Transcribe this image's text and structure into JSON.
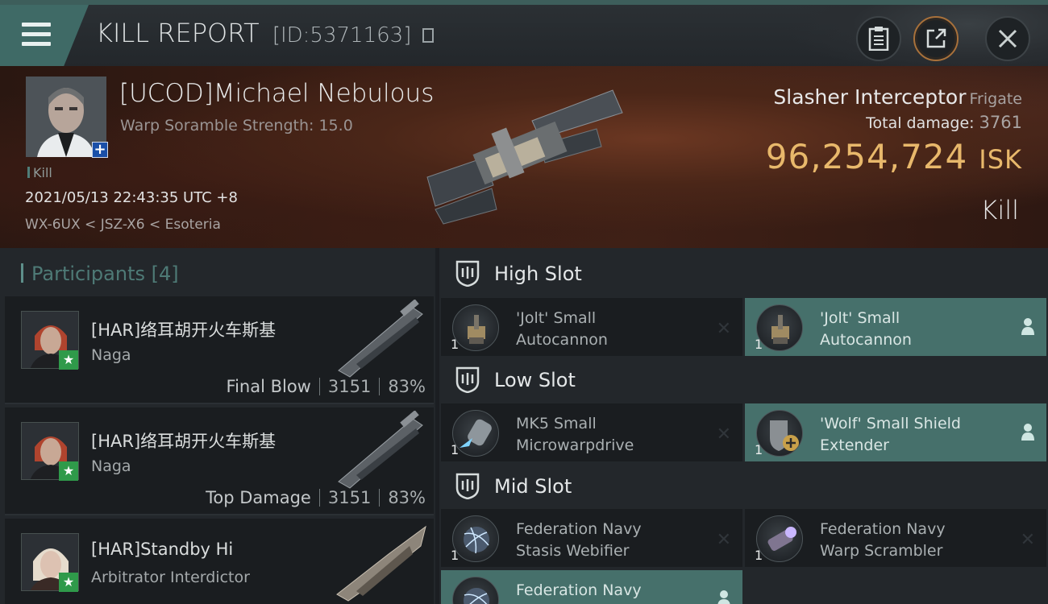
{
  "header": {
    "title": "KILL REPORT",
    "report_id": "[ID:5371163]",
    "buttons": [
      "clipboard",
      "share",
      "close"
    ]
  },
  "victim": {
    "name": "[UCOD]Michael Nebulous",
    "scramble": "Warp Soramble Strength: 15.0",
    "tag": "Kill",
    "timestamp": "2021/05/13 22:43:35 UTC +8",
    "location": "WX-6UX < JSZ-X6 < Esoteria",
    "ship": "Slasher Interceptor",
    "ship_class": "Frigate",
    "damage_label": "Total damage:",
    "damage_value": "3761",
    "isk_value": "96,254,724",
    "isk_unit": "ISK",
    "outcome": "Kill"
  },
  "participants": {
    "label": "Participants",
    "count": "[4]",
    "rows": [
      {
        "name": "[HAR]络耳胡开火车斯基",
        "ship": "Naga",
        "role": "Final Blow",
        "damage": "3151",
        "percent": "83%"
      },
      {
        "name": "[HAR]络耳胡开火车斯基",
        "ship": "Naga",
        "role": "Top Damage",
        "damage": "3151",
        "percent": "83%"
      },
      {
        "name": "[HAR]Standby Hi",
        "ship": "Arbitrator Interdictor",
        "role": "",
        "damage": "",
        "percent": ""
      }
    ]
  },
  "fitting": {
    "high_slot": "High Slot",
    "low_slot": "Low Slot",
    "mid_slot": "Mid Slot",
    "modules": [
      {
        "name1": "'Jolt' Small",
        "name2": "Autocannon",
        "qty": "1",
        "state": "destroyed"
      },
      {
        "name1": "'Jolt' Small",
        "name2": "Autocannon",
        "qty": "1",
        "state": "dropped"
      },
      {
        "name1": "MK5 Small",
        "name2": "Microwarpdrive",
        "qty": "1",
        "state": "destroyed"
      },
      {
        "name1": "'Wolf' Small Shield",
        "name2": "Extender",
        "qty": "1",
        "state": "dropped"
      },
      {
        "name1": "Federation Navy",
        "name2": "Stasis Webifier",
        "qty": "1",
        "state": "destroyed"
      },
      {
        "name1": "Federation Navy",
        "name2": "Warp Scrambler",
        "qty": "1",
        "state": "destroyed"
      },
      {
        "name1": "Federation Navy",
        "name2": "",
        "qty": "",
        "state": "dropped"
      }
    ],
    "state_symbols": {
      "destroyed": "✕",
      "dropped": "person-icon"
    }
  },
  "colors": {
    "accent_teal": "#46706b",
    "isk_gold": "#e8b86b",
    "menu_teal": "#3f6a66"
  }
}
